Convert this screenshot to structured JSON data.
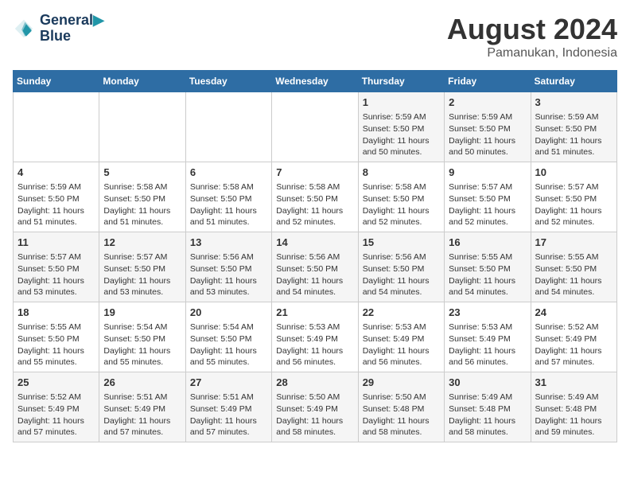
{
  "header": {
    "logo_line1": "General",
    "logo_line2": "Blue",
    "month": "August 2024",
    "location": "Pamanukan, Indonesia"
  },
  "weekdays": [
    "Sunday",
    "Monday",
    "Tuesday",
    "Wednesday",
    "Thursday",
    "Friday",
    "Saturday"
  ],
  "weeks": [
    [
      {
        "day": "",
        "info": ""
      },
      {
        "day": "",
        "info": ""
      },
      {
        "day": "",
        "info": ""
      },
      {
        "day": "",
        "info": ""
      },
      {
        "day": "1",
        "info": "Sunrise: 5:59 AM\nSunset: 5:50 PM\nDaylight: 11 hours\nand 50 minutes."
      },
      {
        "day": "2",
        "info": "Sunrise: 5:59 AM\nSunset: 5:50 PM\nDaylight: 11 hours\nand 50 minutes."
      },
      {
        "day": "3",
        "info": "Sunrise: 5:59 AM\nSunset: 5:50 PM\nDaylight: 11 hours\nand 51 minutes."
      }
    ],
    [
      {
        "day": "4",
        "info": "Sunrise: 5:59 AM\nSunset: 5:50 PM\nDaylight: 11 hours\nand 51 minutes."
      },
      {
        "day": "5",
        "info": "Sunrise: 5:58 AM\nSunset: 5:50 PM\nDaylight: 11 hours\nand 51 minutes."
      },
      {
        "day": "6",
        "info": "Sunrise: 5:58 AM\nSunset: 5:50 PM\nDaylight: 11 hours\nand 51 minutes."
      },
      {
        "day": "7",
        "info": "Sunrise: 5:58 AM\nSunset: 5:50 PM\nDaylight: 11 hours\nand 52 minutes."
      },
      {
        "day": "8",
        "info": "Sunrise: 5:58 AM\nSunset: 5:50 PM\nDaylight: 11 hours\nand 52 minutes."
      },
      {
        "day": "9",
        "info": "Sunrise: 5:57 AM\nSunset: 5:50 PM\nDaylight: 11 hours\nand 52 minutes."
      },
      {
        "day": "10",
        "info": "Sunrise: 5:57 AM\nSunset: 5:50 PM\nDaylight: 11 hours\nand 52 minutes."
      }
    ],
    [
      {
        "day": "11",
        "info": "Sunrise: 5:57 AM\nSunset: 5:50 PM\nDaylight: 11 hours\nand 53 minutes."
      },
      {
        "day": "12",
        "info": "Sunrise: 5:57 AM\nSunset: 5:50 PM\nDaylight: 11 hours\nand 53 minutes."
      },
      {
        "day": "13",
        "info": "Sunrise: 5:56 AM\nSunset: 5:50 PM\nDaylight: 11 hours\nand 53 minutes."
      },
      {
        "day": "14",
        "info": "Sunrise: 5:56 AM\nSunset: 5:50 PM\nDaylight: 11 hours\nand 54 minutes."
      },
      {
        "day": "15",
        "info": "Sunrise: 5:56 AM\nSunset: 5:50 PM\nDaylight: 11 hours\nand 54 minutes."
      },
      {
        "day": "16",
        "info": "Sunrise: 5:55 AM\nSunset: 5:50 PM\nDaylight: 11 hours\nand 54 minutes."
      },
      {
        "day": "17",
        "info": "Sunrise: 5:55 AM\nSunset: 5:50 PM\nDaylight: 11 hours\nand 54 minutes."
      }
    ],
    [
      {
        "day": "18",
        "info": "Sunrise: 5:55 AM\nSunset: 5:50 PM\nDaylight: 11 hours\nand 55 minutes."
      },
      {
        "day": "19",
        "info": "Sunrise: 5:54 AM\nSunset: 5:50 PM\nDaylight: 11 hours\nand 55 minutes."
      },
      {
        "day": "20",
        "info": "Sunrise: 5:54 AM\nSunset: 5:50 PM\nDaylight: 11 hours\nand 55 minutes."
      },
      {
        "day": "21",
        "info": "Sunrise: 5:53 AM\nSunset: 5:49 PM\nDaylight: 11 hours\nand 56 minutes."
      },
      {
        "day": "22",
        "info": "Sunrise: 5:53 AM\nSunset: 5:49 PM\nDaylight: 11 hours\nand 56 minutes."
      },
      {
        "day": "23",
        "info": "Sunrise: 5:53 AM\nSunset: 5:49 PM\nDaylight: 11 hours\nand 56 minutes."
      },
      {
        "day": "24",
        "info": "Sunrise: 5:52 AM\nSunset: 5:49 PM\nDaylight: 11 hours\nand 57 minutes."
      }
    ],
    [
      {
        "day": "25",
        "info": "Sunrise: 5:52 AM\nSunset: 5:49 PM\nDaylight: 11 hours\nand 57 minutes."
      },
      {
        "day": "26",
        "info": "Sunrise: 5:51 AM\nSunset: 5:49 PM\nDaylight: 11 hours\nand 57 minutes."
      },
      {
        "day": "27",
        "info": "Sunrise: 5:51 AM\nSunset: 5:49 PM\nDaylight: 11 hours\nand 57 minutes."
      },
      {
        "day": "28",
        "info": "Sunrise: 5:50 AM\nSunset: 5:49 PM\nDaylight: 11 hours\nand 58 minutes."
      },
      {
        "day": "29",
        "info": "Sunrise: 5:50 AM\nSunset: 5:48 PM\nDaylight: 11 hours\nand 58 minutes."
      },
      {
        "day": "30",
        "info": "Sunrise: 5:49 AM\nSunset: 5:48 PM\nDaylight: 11 hours\nand 58 minutes."
      },
      {
        "day": "31",
        "info": "Sunrise: 5:49 AM\nSunset: 5:48 PM\nDaylight: 11 hours\nand 59 minutes."
      }
    ]
  ]
}
